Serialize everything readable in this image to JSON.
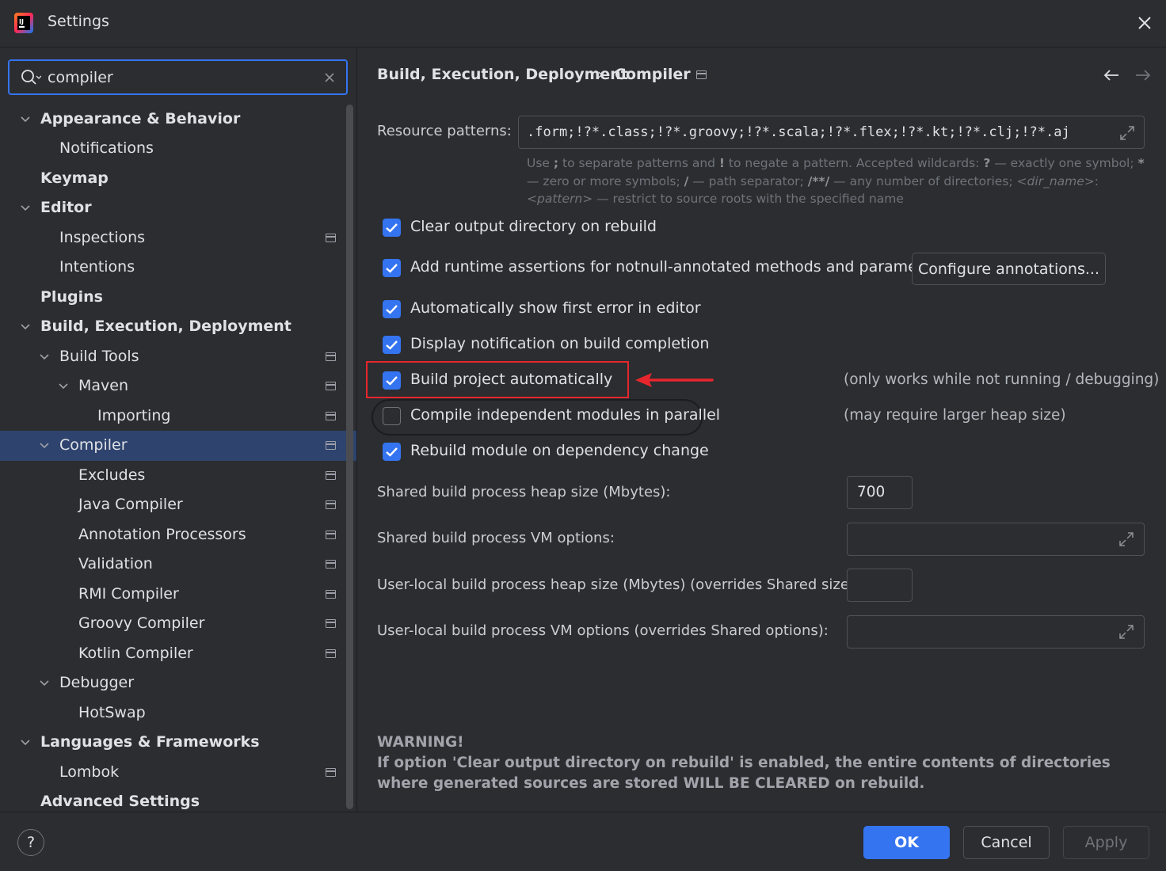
{
  "window": {
    "title": "Settings",
    "logo_icon": "intellij-idea-icon",
    "close_icon": "close-icon"
  },
  "search": {
    "value": "compiler",
    "icon": "search-icon",
    "clear_icon": "clear-icon"
  },
  "sidebar": {
    "items": [
      {
        "label": "Appearance & Behavior",
        "bold": true,
        "expanded": true
      },
      {
        "label": "Notifications"
      },
      {
        "label": "Keymap",
        "bold": true
      },
      {
        "label": "Editor",
        "bold": true,
        "expanded": true
      },
      {
        "label": "Inspections"
      },
      {
        "label": "Intentions"
      },
      {
        "label": "Plugins",
        "bold": true
      },
      {
        "label": "Build, Execution, Deployment",
        "bold": true,
        "expanded": true
      },
      {
        "label": "Build Tools",
        "expanded": true
      },
      {
        "label": "Maven",
        "expanded": true
      },
      {
        "label": "Importing"
      },
      {
        "label": "Compiler",
        "expanded": true,
        "selected": true
      },
      {
        "label": "Excludes"
      },
      {
        "label": "Java Compiler"
      },
      {
        "label": "Annotation Processors"
      },
      {
        "label": "Validation"
      },
      {
        "label": "RMI Compiler"
      },
      {
        "label": "Groovy Compiler"
      },
      {
        "label": "Kotlin Compiler"
      },
      {
        "label": "Debugger",
        "expanded": true
      },
      {
        "label": "HotSwap"
      },
      {
        "label": "Languages & Frameworks",
        "bold": true,
        "expanded": true
      },
      {
        "label": "Lombok"
      },
      {
        "label": "Advanced Settings",
        "bold": true
      }
    ]
  },
  "header": {
    "breadcrumb_parent": "Build, Execution, Deployment",
    "breadcrumb_separator": "›",
    "breadcrumb_current": "Compiler",
    "back_icon": "arrow-left-icon",
    "forward_icon": "arrow-right-icon"
  },
  "compiler": {
    "resource_patterns_label": "Resource patterns:",
    "resource_patterns_value": ".form;!?*.class;!?*.groovy;!?*.scala;!?*.flex;!?*.kt;!?*.clj;!?*.aj",
    "hint_p1": "Use ",
    "hint_b1": ";",
    "hint_p2": " to separate patterns and ",
    "hint_b2": "!",
    "hint_p3": " to negate a pattern. Accepted wildcards: ",
    "hint_b3": "?",
    "hint_p4": " — exactly one symbol; ",
    "hint_b4": "*",
    "hint_p5": " — zero or more symbols; ",
    "hint_b5": "/",
    "hint_p6": " — path separator; ",
    "hint_b6": "/**/",
    "hint_p7": " — any number of directories; ",
    "hint_i1": "<dir_name>",
    "hint_p8": ":",
    "hint_i2": "<pattern>",
    "hint_p9": " — restrict to source roots with the specified name",
    "checkboxes": [
      {
        "label": "Clear output directory on rebuild",
        "checked": true
      },
      {
        "label": "Add runtime assertions for notnull-annotated methods and parameters",
        "checked": true
      },
      {
        "label": "Automatically show first error in editor",
        "checked": true
      },
      {
        "label": "Display notification on build completion",
        "checked": true
      },
      {
        "label": "Build project automatically",
        "checked": true,
        "note": "(only works while not running / debugging)"
      },
      {
        "label": "Compile independent modules in parallel",
        "checked": false,
        "note": "(may require larger heap size)"
      },
      {
        "label": "Rebuild module on dependency change",
        "checked": true
      }
    ],
    "configure_annotations_label": "Configure annotations...",
    "shared_heap_label": "Shared build process heap size (Mbytes):",
    "shared_heap_value": "700",
    "shared_vm_label": "Shared build process VM options:",
    "shared_vm_value": "",
    "local_heap_label": "User-local build process heap size (Mbytes) (overrides Shared size):",
    "local_heap_value": "",
    "local_vm_label": "User-local build process VM options (overrides Shared options):",
    "local_vm_value": "",
    "expand_icon": "expand-icon",
    "warning_title": "WARNING!",
    "warning_text": "If option 'Clear output directory on rebuild' is enabled, the entire contents of directories where generated sources are stored WILL BE CLEARED on rebuild."
  },
  "annotation": {
    "highlight_color": "#e8262d",
    "arrow_icon": "red-arrow-icon"
  },
  "footer": {
    "help_label": "?",
    "ok_label": "OK",
    "cancel_label": "Cancel",
    "apply_label": "Apply"
  },
  "colors": {
    "background": "#2b2d30",
    "accent": "#3574f0",
    "selected": "#2e436e",
    "annotation_red": "#e8262d"
  }
}
